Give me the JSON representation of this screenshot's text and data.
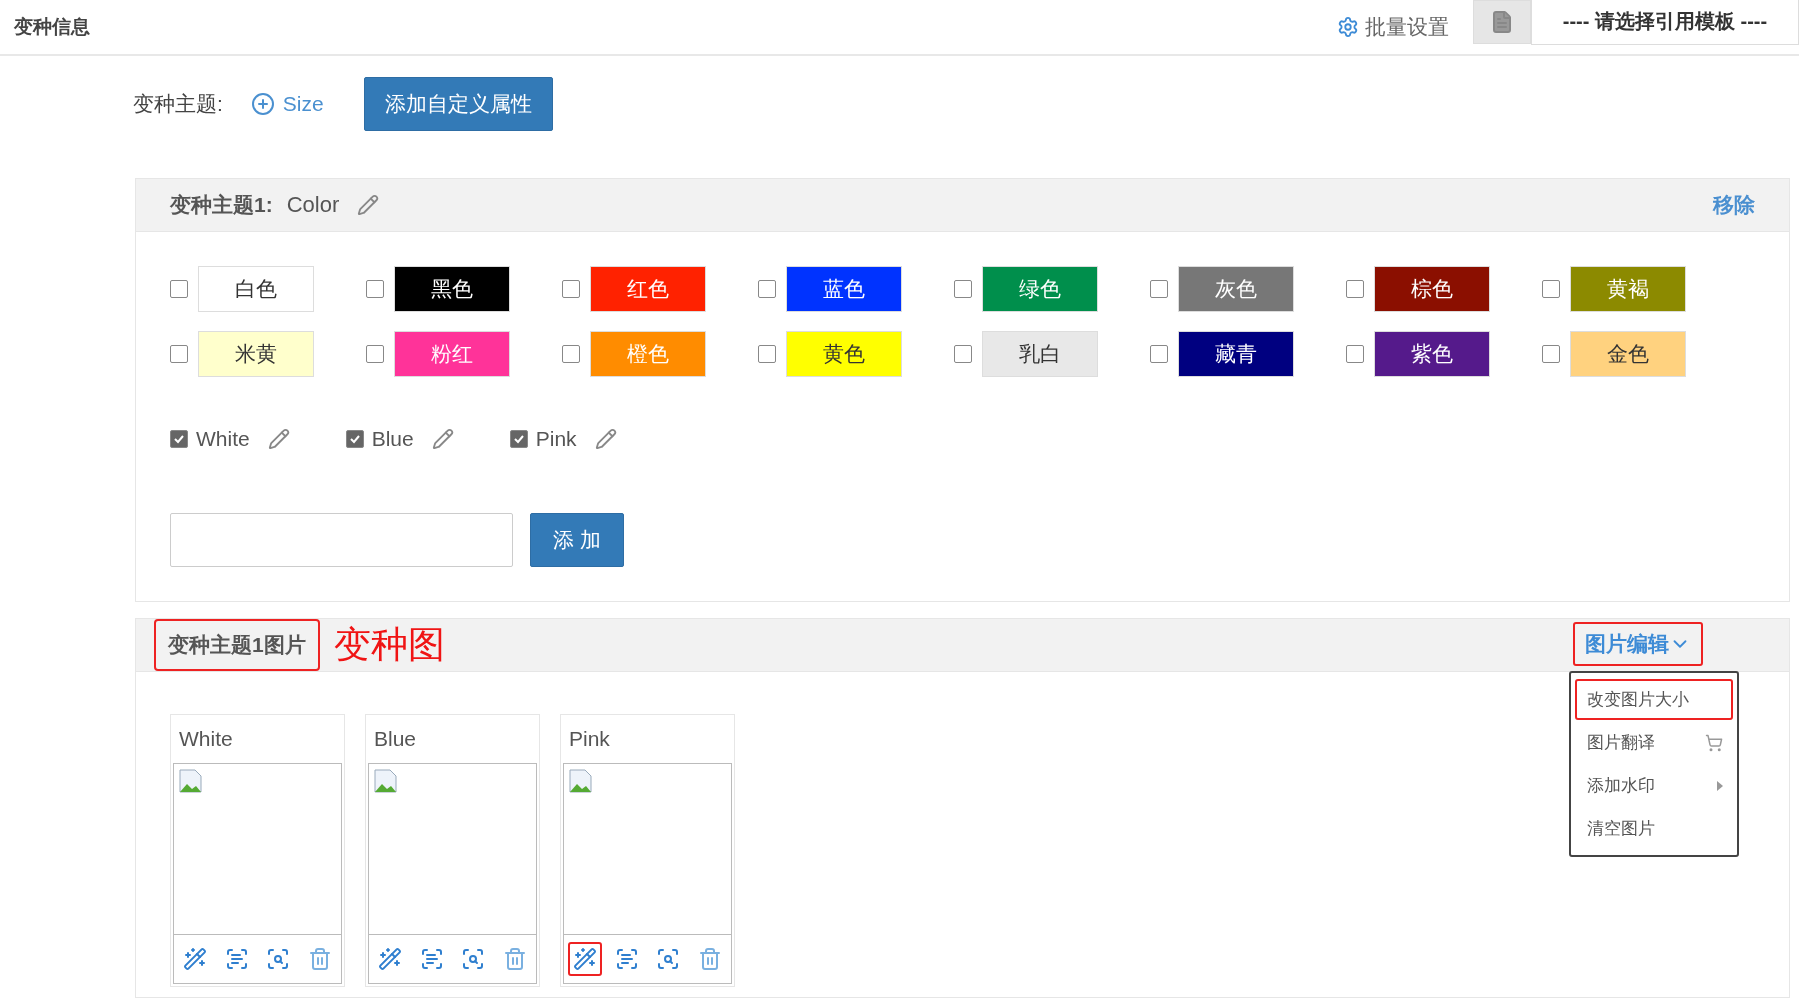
{
  "header": {
    "title": "变种信息",
    "batch_label": "批量设置",
    "template_select": "---- 请选择引用模板 ----"
  },
  "theme_row": {
    "label": "变种主题:",
    "add_theme": "Size",
    "custom_button": "添加自定义属性"
  },
  "color_panel": {
    "title": "变种主题1:",
    "name": "Color",
    "remove": "移除",
    "swatches": [
      {
        "label": "白色",
        "color": "#ffffff",
        "checked": false
      },
      {
        "label": "黑色",
        "color": "#000000",
        "checked": false
      },
      {
        "label": "红色",
        "color": "#ff2200",
        "checked": false
      },
      {
        "label": "蓝色",
        "color": "#0033ff",
        "checked": false
      },
      {
        "label": "绿色",
        "color": "#008f4c",
        "checked": false
      },
      {
        "label": "灰色",
        "color": "#777777",
        "checked": false
      },
      {
        "label": "棕色",
        "color": "#8b0f00",
        "checked": false
      },
      {
        "label": "黄褐",
        "color": "#8c8a00",
        "checked": false
      },
      {
        "label": "米黄",
        "color": "#ffffcc",
        "checked": false
      },
      {
        "label": "粉红",
        "color": "#ff3399",
        "checked": false
      },
      {
        "label": "橙色",
        "color": "#ff8c00",
        "checked": false
      },
      {
        "label": "黄色",
        "color": "#ffff00",
        "checked": false
      },
      {
        "label": "乳白",
        "color": "#e8e8e8",
        "checked": false
      },
      {
        "label": "藏青",
        "color": "#000080",
        "checked": false
      },
      {
        "label": "紫色",
        "color": "#551a8b",
        "checked": false
      },
      {
        "label": "金色",
        "color": "#ffd27f",
        "checked": false
      }
    ],
    "values": [
      {
        "label": "White",
        "checked": true
      },
      {
        "label": "Blue",
        "checked": true
      },
      {
        "label": "Pink",
        "checked": true
      }
    ],
    "add_button": "添 加"
  },
  "image_panel": {
    "title": "变种主题1图片",
    "title_highlighted": true,
    "annotation": "变种图",
    "edit_menu": "图片编辑",
    "edit_highlighted": true,
    "menu_items": [
      {
        "label": "改变图片大小",
        "kind": "plain",
        "highlighted": true
      },
      {
        "label": "图片翻译",
        "kind": "cart",
        "highlighted": false
      },
      {
        "label": "添加水印",
        "kind": "submenu",
        "highlighted": false
      },
      {
        "label": "清空图片",
        "kind": "plain",
        "highlighted": false
      }
    ],
    "cards": [
      {
        "title": "White",
        "tools": [
          {
            "kind": "wand",
            "highlighted": false
          },
          {
            "kind": "text",
            "highlighted": false
          },
          {
            "kind": "zoom",
            "highlighted": false
          },
          {
            "kind": "trash",
            "highlighted": false
          }
        ]
      },
      {
        "title": "Blue",
        "tools": [
          {
            "kind": "wand",
            "highlighted": false
          },
          {
            "kind": "text",
            "highlighted": false
          },
          {
            "kind": "zoom",
            "highlighted": false
          },
          {
            "kind": "trash",
            "highlighted": false
          }
        ]
      },
      {
        "title": "Pink",
        "tools": [
          {
            "kind": "wand",
            "highlighted": true
          },
          {
            "kind": "text",
            "highlighted": false
          },
          {
            "kind": "zoom",
            "highlighted": false
          },
          {
            "kind": "trash",
            "highlighted": false
          }
        ]
      }
    ]
  }
}
